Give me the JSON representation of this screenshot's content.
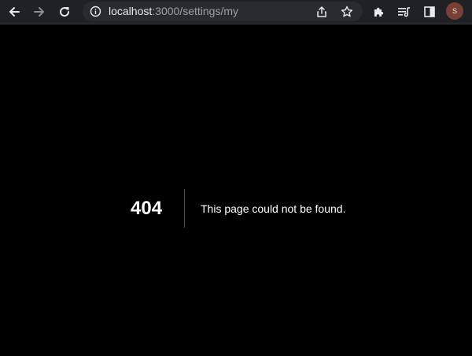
{
  "browser": {
    "url_host": "localhost",
    "url_rest": ":3000/settings/my",
    "profile_initial": "S",
    "icons": {
      "back": "arrow-left-icon",
      "forward": "arrow-right-icon",
      "reload": "reload-icon",
      "site_info": "info-icon",
      "share": "share-icon",
      "bookmark": "star-icon",
      "extensions": "puzzle-icon",
      "reading_list": "reading-list-icon",
      "side_panel": "side-panel-icon"
    },
    "colors": {
      "toolbar": "#202124",
      "omnibox": "#2a2b2e",
      "avatar": "#7a3f37"
    }
  },
  "page": {
    "error_code": "404",
    "error_message": "This page could not be found.",
    "background": "#000000"
  }
}
